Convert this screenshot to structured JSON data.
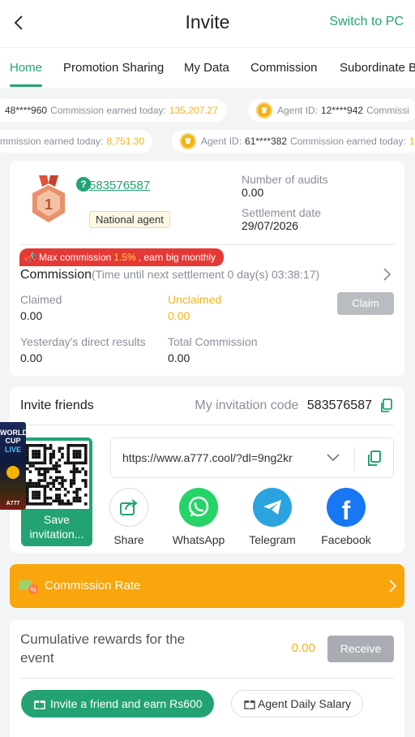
{
  "header": {
    "title": "Invite",
    "switch_label": "Switch to PC"
  },
  "tabs": [
    "Home",
    "Promotion Sharing",
    "My Data",
    "Commission",
    "Subordinate B"
  ],
  "ticker": {
    "row1": [
      {
        "id": "48****960",
        "label": "Commission earned today:",
        "amount": "135,207.27"
      },
      {
        "agent_prefix": "Agent ID:",
        "id": "12****942",
        "label": "Commissi"
      }
    ],
    "row2": [
      {
        "label": "mmission earned today:",
        "amount": "8,751.30"
      },
      {
        "agent_prefix": "Agent ID:",
        "id": "61****382",
        "label": "Commission earned today:",
        "amount": "1"
      }
    ]
  },
  "agent": {
    "id": "583576587",
    "level": "1",
    "badge": "National agent",
    "audits_label": "Number of audits",
    "audits_value": "0.00",
    "settlement_label": "Settlement date",
    "settlement_value": "29/07/2026"
  },
  "commission": {
    "banner_prefix": "Max commission",
    "banner_rate": "1.5%",
    "banner_suffix": ", earn big monthly",
    "title": "Commission",
    "time_text": "(Time until next settlement  0 day(s) 03:38:17)",
    "claimed_label": "Claimed",
    "claimed_value": "0.00",
    "unclaimed_label": "Unclaimed",
    "unclaimed_value": "0.00",
    "claim_button": "Claim",
    "yesterday_label": "Yesterday's direct results",
    "yesterday_value": "0.00",
    "total_label": "Total Commission",
    "total_value": "0.00"
  },
  "invite": {
    "title": "Invite friends",
    "code_label": "My invitation code",
    "code_value": "583576587",
    "qr_save_label": "Save invitation...",
    "url": "https://www.a777.cool/?dl=9ng2kr",
    "share_items": [
      {
        "label": "Share",
        "icon": "share-icon",
        "color": "#ffffff"
      },
      {
        "label": "WhatsApp",
        "icon": "whatsapp-icon",
        "color": "#25d366"
      },
      {
        "label": "Telegram",
        "icon": "telegram-icon",
        "color": "#2aa3df"
      },
      {
        "label": "Facebook",
        "icon": "facebook-icon",
        "color": "#1877f2"
      }
    ],
    "promo_thumb": {
      "line1": "WORLD",
      "line2": "CUP",
      "line3": "LIVE",
      "brand": "A777"
    }
  },
  "commission_rate": {
    "label": "Commission Rate"
  },
  "rewards": {
    "title": "Cumulative rewards for the event",
    "amount": "0.00",
    "receive_button": "Receive",
    "invite_button": "Invite a friend and earn Rs600",
    "salary_button": "Agent Daily Salary"
  },
  "colors": {
    "brand_green": "#23a374",
    "accent_amber": "#f5b21a",
    "orange_bar": "#f8a60c",
    "banner_red": "#e53935"
  }
}
